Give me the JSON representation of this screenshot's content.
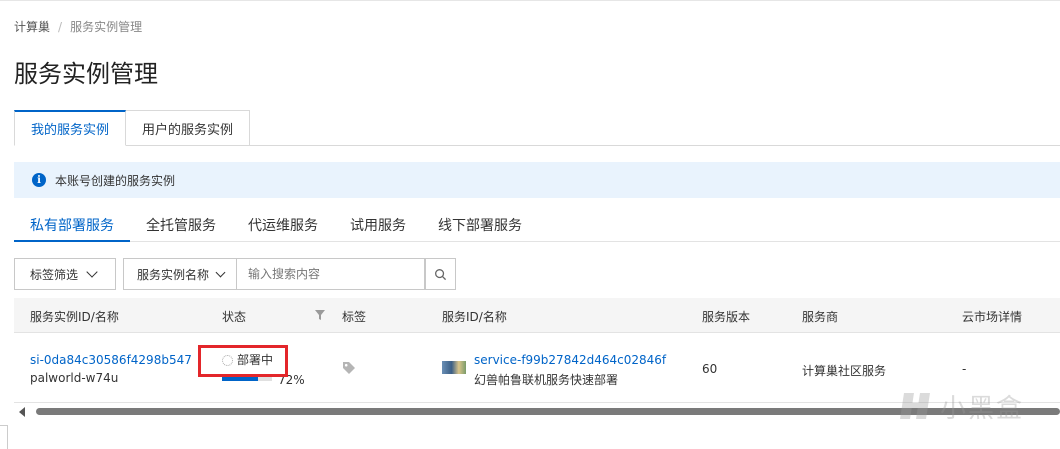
{
  "breadcrumb": {
    "root": "计算巢",
    "separator": "/",
    "current": "服务实例管理"
  },
  "page_title": "服务实例管理",
  "top_tabs": [
    {
      "label": "我的服务实例",
      "active": true
    },
    {
      "label": "用户的服务实例",
      "active": false
    }
  ],
  "info_bar": {
    "text": "本账号创建的服务实例"
  },
  "sub_tabs": [
    {
      "label": "私有部署服务",
      "active": true
    },
    {
      "label": "全托管服务",
      "active": false
    },
    {
      "label": "代运维服务",
      "active": false
    },
    {
      "label": "试用服务",
      "active": false
    },
    {
      "label": "线下部署服务",
      "active": false
    }
  ],
  "filters": {
    "tag_filter_label": "标签筛选",
    "search_field_label": "服务实例名称",
    "search_placeholder": "输入搜索内容"
  },
  "table": {
    "columns": [
      "服务实例ID/名称",
      "状态",
      "标签",
      "服务ID/名称",
      "服务版本",
      "服务商",
      "云市场详情"
    ],
    "rows": [
      {
        "instance_id": "si-0da84c30586f4298b547",
        "instance_name": "palworld-w74u",
        "status": "部署中",
        "progress_percent": 72,
        "progress_label": "72%",
        "service_id": "service-f99b27842d464c02846f",
        "service_name": "幻兽帕鲁联机服务快速部署",
        "version": "60",
        "provider": "计算巢社区服务",
        "marketplace": "-"
      }
    ]
  },
  "watermark": {
    "text": "小黑盒"
  },
  "colors": {
    "accent": "#0064c8",
    "highlight_box": "#e3262a",
    "info_bg": "#e9f3fd"
  }
}
